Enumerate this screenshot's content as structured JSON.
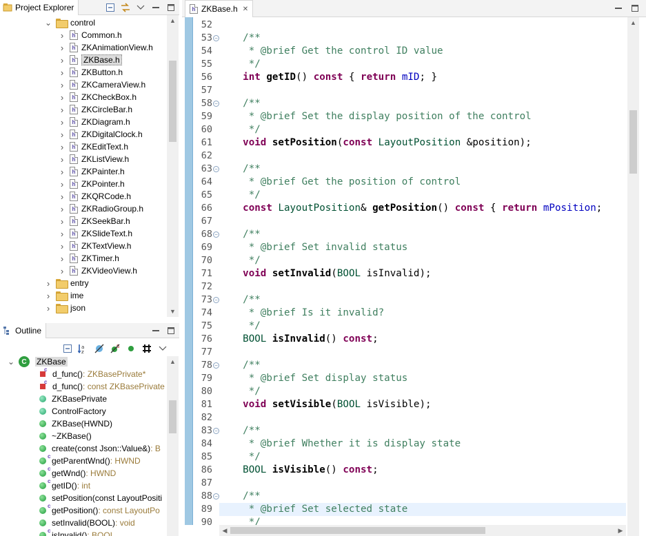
{
  "project_explorer": {
    "title": "Project Explorer",
    "tree": [
      {
        "label": "control",
        "kind": "folder",
        "expanded": true
      },
      {
        "label": "Common.h",
        "kind": "file"
      },
      {
        "label": "ZKAnimationView.h",
        "kind": "file"
      },
      {
        "label": "ZKBase.h",
        "kind": "file",
        "selected": true
      },
      {
        "label": "ZKButton.h",
        "kind": "file"
      },
      {
        "label": "ZKCameraView.h",
        "kind": "file"
      },
      {
        "label": "ZKCheckBox.h",
        "kind": "file"
      },
      {
        "label": "ZKCircleBar.h",
        "kind": "file"
      },
      {
        "label": "ZKDiagram.h",
        "kind": "file"
      },
      {
        "label": "ZKDigitalClock.h",
        "kind": "file"
      },
      {
        "label": "ZKEditText.h",
        "kind": "file"
      },
      {
        "label": "ZKListView.h",
        "kind": "file"
      },
      {
        "label": "ZKPainter.h",
        "kind": "file"
      },
      {
        "label": "ZKPointer.h",
        "kind": "file"
      },
      {
        "label": "ZKQRCode.h",
        "kind": "file"
      },
      {
        "label": "ZKRadioGroup.h",
        "kind": "file"
      },
      {
        "label": "ZKSeekBar.h",
        "kind": "file"
      },
      {
        "label": "ZKSlideText.h",
        "kind": "file"
      },
      {
        "label": "ZKTextView.h",
        "kind": "file"
      },
      {
        "label": "ZKTimer.h",
        "kind": "file"
      },
      {
        "label": "ZKVideoView.h",
        "kind": "file"
      },
      {
        "label": "entry",
        "kind": "folder",
        "expanded": false
      },
      {
        "label": "ime",
        "kind": "folder",
        "expanded": false
      },
      {
        "label": "json",
        "kind": "folder",
        "expanded": false
      }
    ]
  },
  "outline": {
    "title": "Outline",
    "root": "ZKBase",
    "items": [
      {
        "name": "d_func()",
        "sig": " : ZKBasePrivate*",
        "icon": "private"
      },
      {
        "name": "d_func()",
        "sig": " : const ZKBasePrivate",
        "icon": "private"
      },
      {
        "name": "ZKBasePrivate",
        "sig": "",
        "icon": "friend"
      },
      {
        "name": "ControlFactory",
        "sig": "",
        "icon": "friend"
      },
      {
        "name": "ZKBase(HWND)",
        "sig": "",
        "icon": "public"
      },
      {
        "name": "~ZKBase()",
        "sig": "",
        "icon": "public"
      },
      {
        "name": "create(const Json::Value&)",
        "sig": " : B",
        "icon": "public"
      },
      {
        "name": "getParentWnd()",
        "sig": " : HWND",
        "icon": "const"
      },
      {
        "name": "getWnd()",
        "sig": " : HWND",
        "icon": "const"
      },
      {
        "name": "getID()",
        "sig": " : int",
        "icon": "const"
      },
      {
        "name": "setPosition(const LayoutPositi",
        "sig": "",
        "icon": "public"
      },
      {
        "name": "getPosition()",
        "sig": " : const LayoutPo",
        "icon": "const"
      },
      {
        "name": "setInvalid(BOOL)",
        "sig": " : void",
        "icon": "public"
      },
      {
        "name": "isInvalid()",
        "sig": " : BOOL",
        "icon": "const"
      }
    ]
  },
  "editor": {
    "tab_label": "ZKBase.h",
    "current_line": 89,
    "lines": [
      {
        "n": "52",
        "fold": false,
        "tokens": []
      },
      {
        "n": "53",
        "fold": true,
        "tokens": [
          {
            "t": "com",
            "v": "    /**"
          }
        ]
      },
      {
        "n": "54",
        "fold": false,
        "tokens": [
          {
            "t": "com",
            "v": "     * @brief Get the control ID value"
          }
        ]
      },
      {
        "n": "55",
        "fold": false,
        "tokens": [
          {
            "t": "com",
            "v": "     */"
          }
        ]
      },
      {
        "n": "56",
        "fold": false,
        "tokens": [
          {
            "t": "",
            "v": "    "
          },
          {
            "t": "kw",
            "v": "int"
          },
          {
            "t": "",
            "v": " "
          },
          {
            "t": "fn",
            "v": "getID"
          },
          {
            "t": "",
            "v": "() "
          },
          {
            "t": "kw",
            "v": "const"
          },
          {
            "t": "",
            "v": " { "
          },
          {
            "t": "kw",
            "v": "return"
          },
          {
            "t": "",
            "v": " "
          },
          {
            "t": "fld",
            "v": "mID"
          },
          {
            "t": "",
            "v": "; }"
          }
        ]
      },
      {
        "n": "57",
        "fold": false,
        "tokens": []
      },
      {
        "n": "58",
        "fold": true,
        "tokens": [
          {
            "t": "com",
            "v": "    /**"
          }
        ]
      },
      {
        "n": "59",
        "fold": false,
        "tokens": [
          {
            "t": "com",
            "v": "     * @brief Set the display position of the control"
          }
        ]
      },
      {
        "n": "60",
        "fold": false,
        "tokens": [
          {
            "t": "com",
            "v": "     */"
          }
        ]
      },
      {
        "n": "61",
        "fold": false,
        "tokens": [
          {
            "t": "",
            "v": "    "
          },
          {
            "t": "kw",
            "v": "void"
          },
          {
            "t": "",
            "v": " "
          },
          {
            "t": "fn",
            "v": "setPosition"
          },
          {
            "t": "",
            "v": "("
          },
          {
            "t": "kw",
            "v": "const"
          },
          {
            "t": "",
            "v": " "
          },
          {
            "t": "type",
            "v": "LayoutPosition"
          },
          {
            "t": "",
            "v": " &position);"
          }
        ]
      },
      {
        "n": "62",
        "fold": false,
        "tokens": []
      },
      {
        "n": "63",
        "fold": true,
        "tokens": [
          {
            "t": "com",
            "v": "    /**"
          }
        ]
      },
      {
        "n": "64",
        "fold": false,
        "tokens": [
          {
            "t": "com",
            "v": "     * @brief Get the position of control"
          }
        ]
      },
      {
        "n": "65",
        "fold": false,
        "tokens": [
          {
            "t": "com",
            "v": "     */"
          }
        ]
      },
      {
        "n": "66",
        "fold": false,
        "tokens": [
          {
            "t": "",
            "v": "    "
          },
          {
            "t": "kw",
            "v": "const"
          },
          {
            "t": "",
            "v": " "
          },
          {
            "t": "type",
            "v": "LayoutPosition"
          },
          {
            "t": "",
            "v": "& "
          },
          {
            "t": "fn",
            "v": "getPosition"
          },
          {
            "t": "",
            "v": "() "
          },
          {
            "t": "kw",
            "v": "const"
          },
          {
            "t": "",
            "v": " { "
          },
          {
            "t": "kw",
            "v": "return"
          },
          {
            "t": "",
            "v": " "
          },
          {
            "t": "fld",
            "v": "mPosition"
          },
          {
            "t": "",
            "v": ";"
          }
        ]
      },
      {
        "n": "67",
        "fold": false,
        "tokens": []
      },
      {
        "n": "68",
        "fold": true,
        "tokens": [
          {
            "t": "com",
            "v": "    /**"
          }
        ]
      },
      {
        "n": "69",
        "fold": false,
        "tokens": [
          {
            "t": "com",
            "v": "     * @brief Set invalid status"
          }
        ]
      },
      {
        "n": "70",
        "fold": false,
        "tokens": [
          {
            "t": "com",
            "v": "     */"
          }
        ]
      },
      {
        "n": "71",
        "fold": false,
        "tokens": [
          {
            "t": "",
            "v": "    "
          },
          {
            "t": "kw",
            "v": "void"
          },
          {
            "t": "",
            "v": " "
          },
          {
            "t": "fn",
            "v": "setInvalid"
          },
          {
            "t": "",
            "v": "("
          },
          {
            "t": "type",
            "v": "BOOL"
          },
          {
            "t": "",
            "v": " isInvalid);"
          }
        ]
      },
      {
        "n": "72",
        "fold": false,
        "tokens": []
      },
      {
        "n": "73",
        "fold": true,
        "tokens": [
          {
            "t": "com",
            "v": "    /**"
          }
        ]
      },
      {
        "n": "74",
        "fold": false,
        "tokens": [
          {
            "t": "com",
            "v": "     * @brief Is it invalid?"
          }
        ]
      },
      {
        "n": "75",
        "fold": false,
        "tokens": [
          {
            "t": "com",
            "v": "     */"
          }
        ]
      },
      {
        "n": "76",
        "fold": false,
        "tokens": [
          {
            "t": "",
            "v": "    "
          },
          {
            "t": "type",
            "v": "BOOL"
          },
          {
            "t": "",
            "v": " "
          },
          {
            "t": "fn",
            "v": "isInvalid"
          },
          {
            "t": "",
            "v": "() "
          },
          {
            "t": "kw",
            "v": "const"
          },
          {
            "t": "",
            "v": ";"
          }
        ]
      },
      {
        "n": "77",
        "fold": false,
        "tokens": []
      },
      {
        "n": "78",
        "fold": true,
        "tokens": [
          {
            "t": "com",
            "v": "    /**"
          }
        ]
      },
      {
        "n": "79",
        "fold": false,
        "tokens": [
          {
            "t": "com",
            "v": "     * @brief Set display status"
          }
        ]
      },
      {
        "n": "80",
        "fold": false,
        "tokens": [
          {
            "t": "com",
            "v": "     */"
          }
        ]
      },
      {
        "n": "81",
        "fold": false,
        "tokens": [
          {
            "t": "",
            "v": "    "
          },
          {
            "t": "kw",
            "v": "void"
          },
          {
            "t": "",
            "v": " "
          },
          {
            "t": "fn",
            "v": "setVisible"
          },
          {
            "t": "",
            "v": "("
          },
          {
            "t": "type",
            "v": "BOOL"
          },
          {
            "t": "",
            "v": " isVisible);"
          }
        ]
      },
      {
        "n": "82",
        "fold": false,
        "tokens": []
      },
      {
        "n": "83",
        "fold": true,
        "tokens": [
          {
            "t": "com",
            "v": "    /**"
          }
        ]
      },
      {
        "n": "84",
        "fold": false,
        "tokens": [
          {
            "t": "com",
            "v": "     * @brief Whether it is display state"
          }
        ]
      },
      {
        "n": "85",
        "fold": false,
        "tokens": [
          {
            "t": "com",
            "v": "     */"
          }
        ]
      },
      {
        "n": "86",
        "fold": false,
        "tokens": [
          {
            "t": "",
            "v": "    "
          },
          {
            "t": "type",
            "v": "BOOL"
          },
          {
            "t": "",
            "v": " "
          },
          {
            "t": "fn",
            "v": "isVisible"
          },
          {
            "t": "",
            "v": "() "
          },
          {
            "t": "kw",
            "v": "const"
          },
          {
            "t": "",
            "v": ";"
          }
        ]
      },
      {
        "n": "87",
        "fold": false,
        "tokens": []
      },
      {
        "n": "88",
        "fold": true,
        "tokens": [
          {
            "t": "com",
            "v": "    /**"
          }
        ]
      },
      {
        "n": "89",
        "fold": false,
        "tokens": [
          {
            "t": "com",
            "v": "     * @brief Set selected state"
          }
        ]
      },
      {
        "n": "90",
        "fold": false,
        "tokens": [
          {
            "t": "com",
            "v": "     */"
          }
        ]
      }
    ]
  }
}
